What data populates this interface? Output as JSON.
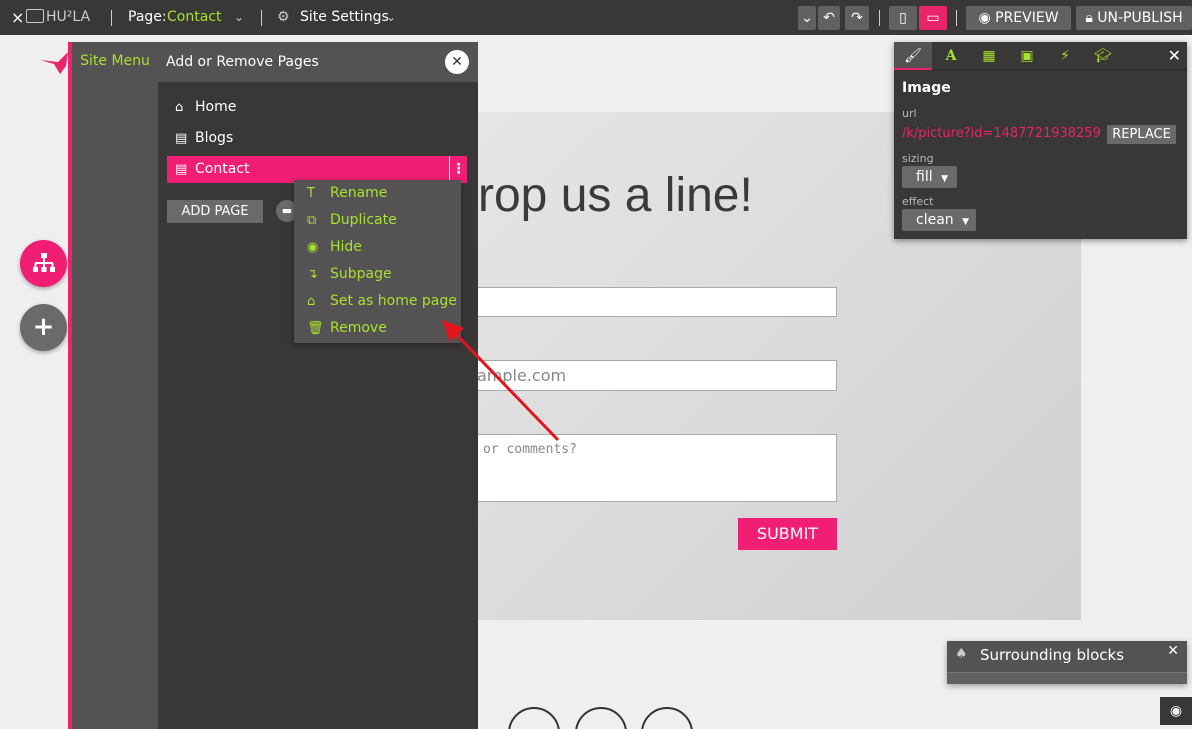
{
  "topbar": {
    "close_glyph": "×",
    "logo_text": "HU²LA",
    "page_label": "Page:",
    "page_name": "Contact",
    "site_settings": "Site Settings",
    "preview": "PREVIEW",
    "unpublish": "UN-PUBLISH"
  },
  "site_menu": {
    "tab_label": "Site Menu",
    "title": "Add or Remove Pages",
    "pages": [
      {
        "label": "Home",
        "icon": "home-icon"
      },
      {
        "label": "Blogs",
        "icon": "page-icon"
      },
      {
        "label": "Contact",
        "icon": "page-icon",
        "selected": true
      }
    ],
    "add_page": "ADD PAGE"
  },
  "context_menu": {
    "items": [
      {
        "label": "Rename",
        "icon": "text-cursor-icon"
      },
      {
        "label": "Duplicate",
        "icon": "duplicate-icon"
      },
      {
        "label": "Hide",
        "icon": "eye-icon"
      },
      {
        "label": "Subpage",
        "icon": "subpage-arrow-icon"
      },
      {
        "label": "Set as home page",
        "icon": "home-icon"
      },
      {
        "label": "Remove",
        "icon": "trash-icon"
      }
    ]
  },
  "canvas": {
    "heading": "rop us a line!",
    "email_placeholder_fragment": "ample.com",
    "comment_placeholder_fragment": "or comments?",
    "submit": "SUBMIT"
  },
  "image_panel": {
    "title": "Image",
    "url_label": "url",
    "url_value": "/k/picture?id=1487721938259",
    "replace": "REPLACE",
    "sizing_label": "sizing",
    "sizing_value": "fill",
    "effect_label": "effect",
    "effect_value": "clean"
  },
  "surrounding": {
    "title": "Surrounding blocks"
  },
  "colors": {
    "accent": "#e8246b",
    "green": "#a6e22e",
    "dark": "#3a3737",
    "mid": "#545252"
  }
}
